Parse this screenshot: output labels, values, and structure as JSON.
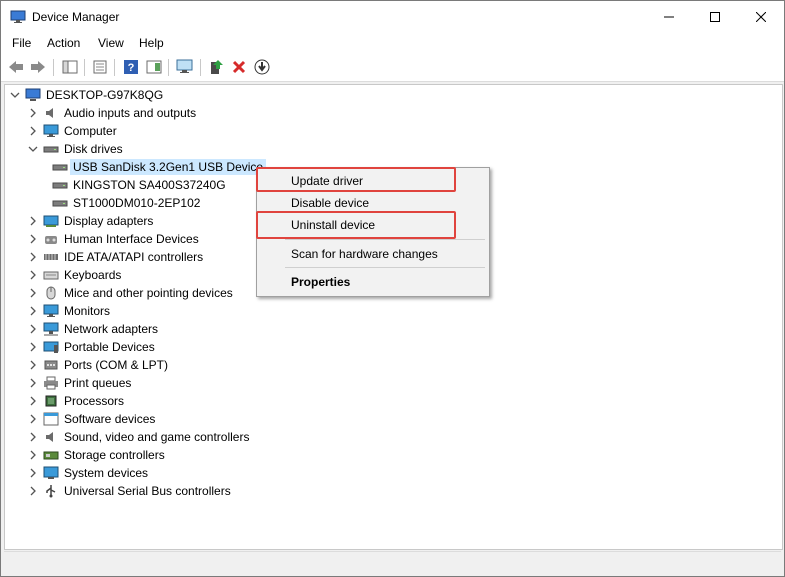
{
  "window": {
    "title": "Device Manager"
  },
  "menu": [
    "File",
    "Action",
    "View",
    "Help"
  ],
  "tree": {
    "root": "DESKTOP-G97K8QG",
    "categories": [
      {
        "label": "Audio inputs and outputs",
        "icon": "speaker-icon"
      },
      {
        "label": "Computer",
        "icon": "monitor-icon"
      },
      {
        "label": "Disk drives",
        "icon": "disk-drive-icon",
        "expanded": true,
        "children": [
          "USB  SanDisk 3.2Gen1 USB Device",
          "KINGSTON SA400S37240G",
          "ST1000DM010-2EP102"
        ]
      },
      {
        "label": "Display adapters",
        "icon": "display-adapter-icon"
      },
      {
        "label": "Human Interface Devices",
        "icon": "hid-icon"
      },
      {
        "label": "IDE ATA/ATAPI controllers",
        "icon": "ide-controller-icon"
      },
      {
        "label": "Keyboards",
        "icon": "keyboard-icon"
      },
      {
        "label": "Mice and other pointing devices",
        "icon": "mouse-icon"
      },
      {
        "label": "Monitors",
        "icon": "monitor-icon"
      },
      {
        "label": "Network adapters",
        "icon": "network-adapter-icon"
      },
      {
        "label": "Portable Devices",
        "icon": "portable-device-icon"
      },
      {
        "label": "Ports (COM & LPT)",
        "icon": "port-icon"
      },
      {
        "label": "Print queues",
        "icon": "printer-icon"
      },
      {
        "label": "Processors",
        "icon": "processor-icon"
      },
      {
        "label": "Software devices",
        "icon": "software-device-icon"
      },
      {
        "label": "Sound, video and game controllers",
        "icon": "speaker-icon"
      },
      {
        "label": "Storage controllers",
        "icon": "storage-controller-icon"
      },
      {
        "label": "System devices",
        "icon": "system-device-icon"
      },
      {
        "label": "Universal Serial Bus controllers",
        "icon": "usb-icon"
      }
    ]
  },
  "context_menu": {
    "update_driver": "Update driver",
    "disable_device": "Disable device",
    "uninstall_device": "Uninstall device",
    "scan_hardware": "Scan for hardware changes",
    "properties": "Properties"
  },
  "colors": {
    "highlight_box": "#e0443e",
    "selection": "#cce8ff"
  }
}
